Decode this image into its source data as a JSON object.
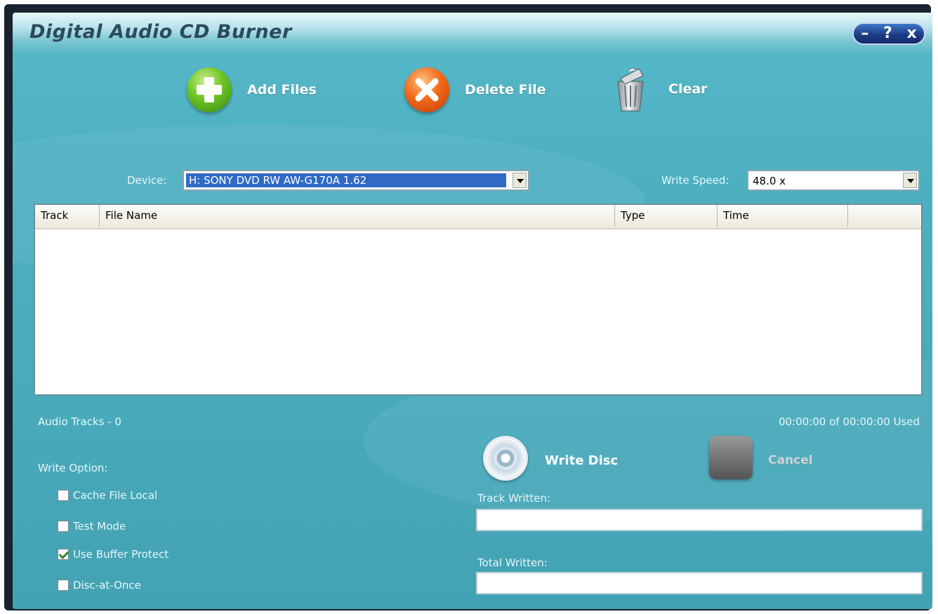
{
  "window": {
    "title": "Digital Audio CD Burner",
    "controls": {
      "minimize": "–",
      "help": "?",
      "close": "x"
    }
  },
  "toolbar": {
    "add_files": "Add Files",
    "delete_file": "Delete File",
    "clear": "Clear"
  },
  "device": {
    "label": "Device:",
    "value": "H: SONY DVD RW AW-G170A 1.62"
  },
  "write_speed": {
    "label": "Write Speed:",
    "value": "48.0 x"
  },
  "track_list": {
    "columns": [
      "Track",
      "File Name",
      "Type",
      "Time"
    ],
    "rows": []
  },
  "status": {
    "audio_tracks": "Audio Tracks - 0",
    "time_used": "00:00:00 of 00:00:00 Used"
  },
  "write_options": {
    "heading": "Write Option:",
    "options": [
      {
        "label": "Cache File Local",
        "checked": false
      },
      {
        "label": "Test Mode",
        "checked": false
      },
      {
        "label": "Use Buffer Protect",
        "checked": true
      },
      {
        "label": "Disc-at-Once",
        "checked": false
      }
    ]
  },
  "actions": {
    "write_disc": "Write Disc",
    "cancel": "Cancel"
  },
  "progress": {
    "track_written_label": "Track Written:",
    "track_written_fraction": 0,
    "total_written_label": "Total Written:",
    "total_written_fraction": 0
  },
  "colors": {
    "background": "#4eb1c2",
    "title_text": "#2c4a5c",
    "selection": "#316ac5"
  }
}
